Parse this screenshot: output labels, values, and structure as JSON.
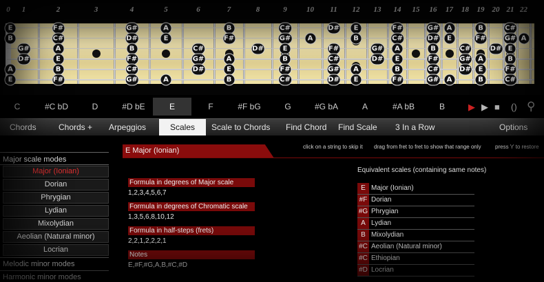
{
  "fretboard": {
    "fret_numbers": [
      "0",
      "1",
      "2",
      "3",
      "4",
      "5",
      "6",
      "7",
      "8",
      "9",
      "10",
      "11",
      "12",
      "13",
      "14",
      "15",
      "16",
      "17",
      "18",
      "19",
      "20",
      "21",
      "22"
    ],
    "notes": [
      {
        "fret": 0,
        "string": 0,
        "label": "E"
      },
      {
        "fret": 0,
        "string": 1,
        "label": "B"
      },
      {
        "fret": 0,
        "string": 4,
        "label": "A"
      },
      {
        "fret": 0,
        "string": 5,
        "label": "E"
      },
      {
        "fret": 1,
        "string": 2,
        "label": "G#"
      },
      {
        "fret": 1,
        "string": 3,
        "label": "D#"
      },
      {
        "fret": 2,
        "string": 0,
        "label": "F#"
      },
      {
        "fret": 2,
        "string": 1,
        "label": "C#"
      },
      {
        "fret": 2,
        "string": 2,
        "label": "A"
      },
      {
        "fret": 2,
        "string": 3,
        "label": "E"
      },
      {
        "fret": 2,
        "string": 4,
        "label": "B"
      },
      {
        "fret": 2,
        "string": 5,
        "label": "F#"
      },
      {
        "fret": 4,
        "string": 0,
        "label": "G#"
      },
      {
        "fret": 4,
        "string": 1,
        "label": "D#"
      },
      {
        "fret": 4,
        "string": 2,
        "label": "B"
      },
      {
        "fret": 4,
        "string": 3,
        "label": "F#"
      },
      {
        "fret": 4,
        "string": 4,
        "label": "C#"
      },
      {
        "fret": 4,
        "string": 5,
        "label": "G#"
      },
      {
        "fret": 5,
        "string": 0,
        "label": "A"
      },
      {
        "fret": 5,
        "string": 1,
        "label": "E"
      },
      {
        "fret": 5,
        "string": 5,
        "label": "A"
      },
      {
        "fret": 6,
        "string": 2,
        "label": "C#"
      },
      {
        "fret": 6,
        "string": 3,
        "label": "G#"
      },
      {
        "fret": 6,
        "string": 4,
        "label": "D#"
      },
      {
        "fret": 7,
        "string": 0,
        "label": "B"
      },
      {
        "fret": 7,
        "string": 1,
        "label": "F#"
      },
      {
        "fret": 7,
        "string": 3,
        "label": "A"
      },
      {
        "fret": 7,
        "string": 4,
        "label": "E"
      },
      {
        "fret": 7,
        "string": 5,
        "label": "B"
      },
      {
        "fret": 8,
        "string": 2,
        "label": "D#"
      },
      {
        "fret": 9,
        "string": 0,
        "label": "C#"
      },
      {
        "fret": 9,
        "string": 1,
        "label": "G#"
      },
      {
        "fret": 9,
        "string": 2,
        "label": "E"
      },
      {
        "fret": 9,
        "string": 3,
        "label": "B"
      },
      {
        "fret": 9,
        "string": 4,
        "label": "F#"
      },
      {
        "fret": 9,
        "string": 5,
        "label": "C#"
      },
      {
        "fret": 10,
        "string": 1,
        "label": "A"
      },
      {
        "fret": 11,
        "string": 0,
        "label": "D#"
      },
      {
        "fret": 11,
        "string": 2,
        "label": "F#"
      },
      {
        "fret": 11,
        "string": 3,
        "label": "C#"
      },
      {
        "fret": 11,
        "string": 4,
        "label": "G#"
      },
      {
        "fret": 11,
        "string": 5,
        "label": "D#"
      },
      {
        "fret": 12,
        "string": 0,
        "label": "E"
      },
      {
        "fret": 12,
        "string": 1,
        "label": "B"
      },
      {
        "fret": 12,
        "string": 4,
        "label": "A"
      },
      {
        "fret": 12,
        "string": 5,
        "label": "E"
      },
      {
        "fret": 13,
        "string": 2,
        "label": "G#"
      },
      {
        "fret": 13,
        "string": 3,
        "label": "D#"
      },
      {
        "fret": 14,
        "string": 0,
        "label": "F#"
      },
      {
        "fret": 14,
        "string": 1,
        "label": "C#"
      },
      {
        "fret": 14,
        "string": 2,
        "label": "A"
      },
      {
        "fret": 14,
        "string": 3,
        "label": "E"
      },
      {
        "fret": 14,
        "string": 4,
        "label": "B"
      },
      {
        "fret": 14,
        "string": 5,
        "label": "F#"
      },
      {
        "fret": 16,
        "string": 0,
        "label": "G#"
      },
      {
        "fret": 16,
        "string": 1,
        "label": "D#"
      },
      {
        "fret": 16,
        "string": 2,
        "label": "B"
      },
      {
        "fret": 16,
        "string": 3,
        "label": "F#"
      },
      {
        "fret": 16,
        "string": 4,
        "label": "C#"
      },
      {
        "fret": 16,
        "string": 5,
        "label": "G#"
      },
      {
        "fret": 17,
        "string": 0,
        "label": "A"
      },
      {
        "fret": 17,
        "string": 1,
        "label": "E"
      },
      {
        "fret": 17,
        "string": 5,
        "label": "A"
      },
      {
        "fret": 18,
        "string": 2,
        "label": "C#"
      },
      {
        "fret": 18,
        "string": 3,
        "label": "G#"
      },
      {
        "fret": 18,
        "string": 4,
        "label": "D#"
      },
      {
        "fret": 19,
        "string": 0,
        "label": "B"
      },
      {
        "fret": 19,
        "string": 1,
        "label": "F#"
      },
      {
        "fret": 19,
        "string": 3,
        "label": "A"
      },
      {
        "fret": 19,
        "string": 4,
        "label": "E"
      },
      {
        "fret": 19,
        "string": 5,
        "label": "B"
      },
      {
        "fret": 20,
        "string": 2,
        "label": "D#"
      },
      {
        "fret": 21,
        "string": 0,
        "label": "C#"
      },
      {
        "fret": 21,
        "string": 1,
        "label": "G#"
      },
      {
        "fret": 21,
        "string": 2,
        "label": "E"
      },
      {
        "fret": 21,
        "string": 3,
        "label": "B"
      },
      {
        "fret": 21,
        "string": 4,
        "label": "F#"
      },
      {
        "fret": 21,
        "string": 5,
        "label": "C#"
      },
      {
        "fret": 22,
        "string": 1,
        "label": "A"
      }
    ]
  },
  "keys": [
    "C",
    "#C  bD",
    "D",
    "#D  bE",
    "E",
    "F",
    "#F  bG",
    "G",
    "#G  bA",
    "A",
    "#A  bB",
    "B"
  ],
  "selected_key": "E",
  "controls": [
    {
      "name": "play-icon",
      "glyph": "▶"
    },
    {
      "name": "step-icon",
      "glyph": "▶"
    },
    {
      "name": "stop-icon",
      "glyph": "■"
    },
    {
      "name": "loop-icon",
      "glyph": "()"
    },
    {
      "name": "zoom-icon",
      "glyph": "⚲"
    }
  ],
  "tabs": [
    "Chords",
    "Chords +",
    "Arpeggios",
    "Scales",
    "Scale to Chords",
    "Find Chord",
    "Find Scale",
    "3 In a Row",
    "Options"
  ],
  "active_tab": "Scales",
  "sidebar": {
    "major_heading": "Major scale modes",
    "modes": [
      "Major (Ionian)",
      "Dorian",
      "Phrygian",
      "Lydian",
      "Mixolydian",
      "Aeolian (Natural minor)",
      "Locrian"
    ],
    "selected_mode": "Major (Ionian)",
    "melodic_heading": "Melodic minor modes",
    "harmonic_heading": "Harmonic minor modes"
  },
  "scale_title": "E Major (Ionian)",
  "instructions": {
    "a": "click on a string to skip it",
    "b": "drag from fret to fret to show that range only",
    "c": "press 'r' to restore"
  },
  "formula": {
    "major_heading": "Formula in degrees of Major scale",
    "major_value": "1,2,3,4,5,6,7",
    "chromatic_heading": "Formula in degrees of Chromatic scale",
    "chromatic_value": "1,3,5,6,8,10,12",
    "halfsteps_heading": "Formula in  half-steps (frets)",
    "halfsteps_value": "2,2,1,2,2,2,1",
    "notes_heading": "Notes",
    "notes_value": "E,#F,#G,A,B,#C,#D"
  },
  "equivalent": {
    "heading": "Equivalent scales  (containing same notes)",
    "rows": [
      {
        "key": "E",
        "name": "Major (Ionian)"
      },
      {
        "key": "#F",
        "name": "Dorian"
      },
      {
        "key": "#G",
        "name": "Phrygian"
      },
      {
        "key": "A",
        "name": "Lydian"
      },
      {
        "key": "B",
        "name": "Mixolydian"
      },
      {
        "key": "#C",
        "name": "Aeolian (Natural minor)"
      },
      {
        "key": "#C",
        "name": "Ethiopian"
      },
      {
        "key": "#D",
        "name": "Locrian"
      }
    ]
  },
  "colors": {
    "accent": "#8a0c0c",
    "selected_mode": "#e23030",
    "play": "#cc2222"
  }
}
